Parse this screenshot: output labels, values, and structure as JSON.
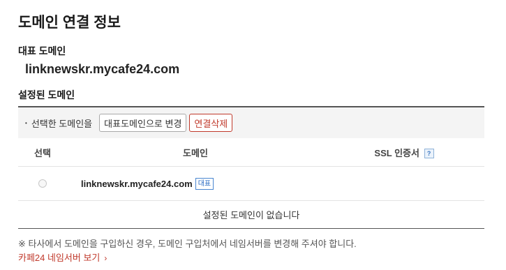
{
  "page": {
    "title": "도메인 연결 정보"
  },
  "primary": {
    "label": "대표 도메인",
    "domain": "linknewskr.mycafe24.com"
  },
  "configured": {
    "label": "설정된 도메인"
  },
  "toolbar": {
    "bullet": "•",
    "text": "선택한 도메인을",
    "set_primary_label": "대표도메인으로 변경",
    "delete_label": "연결삭제"
  },
  "table": {
    "headers": {
      "select": "선택",
      "domain": "도메인",
      "ssl": "SSL 인증서"
    },
    "help_icon": "?",
    "rows": [
      {
        "domain": "linknewskr.mycafe24.com",
        "badge": "대표"
      }
    ],
    "empty_message": "설정된 도메인이 없습니다"
  },
  "notice": "※ 타사에서 도메인을 구입하신 경우, 도메인 구입처에서 네임서버를 변경해 주셔야 합니다.",
  "link": {
    "label": "카페24 네임서버 보기",
    "chevron": "›"
  },
  "colors": {
    "accent_red": "#c0392b",
    "badge_blue": "#2f6fc4"
  }
}
